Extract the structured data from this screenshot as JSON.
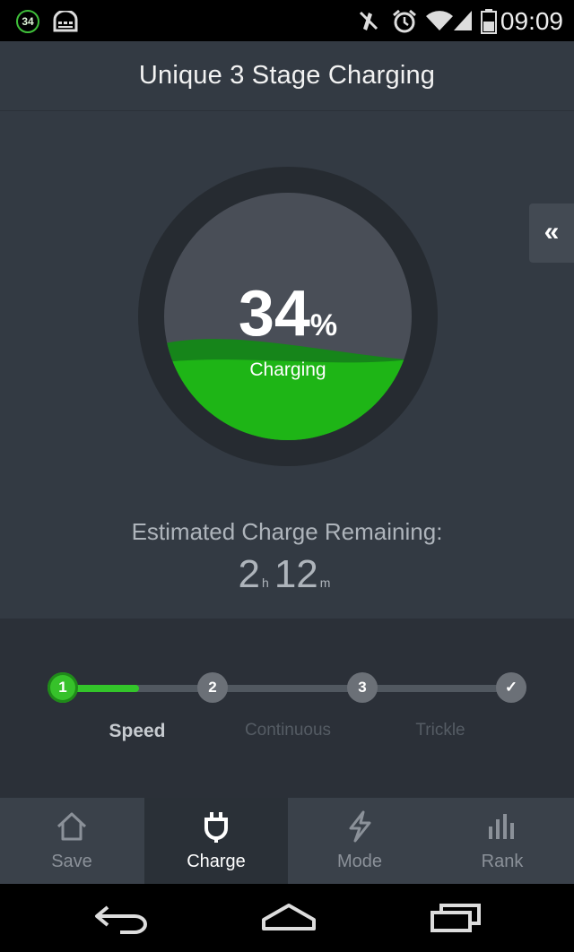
{
  "status_bar": {
    "badge": "34",
    "time": "09:09",
    "icons": [
      "battery-badge-icon",
      "keyboard-icon",
      "mute-icon",
      "alarm-icon",
      "wifi-icon",
      "signal-icon",
      "battery-icon"
    ]
  },
  "app": {
    "title": "Unique 3 Stage Charging",
    "side_tab_label": "«"
  },
  "gauge": {
    "percent": "34",
    "percent_unit": "%",
    "state": "Charging",
    "level": 0.34,
    "colors": {
      "fill": "#1eb516",
      "ring": "#262b31",
      "face": "#494e57"
    }
  },
  "estimate": {
    "label": "Estimated Charge Remaining:",
    "hours": "2",
    "hours_unit": "h",
    "minutes": "12",
    "minutes_unit": "m"
  },
  "stages": {
    "progress": 0.17,
    "nodes": [
      "1",
      "2",
      "3",
      "✓"
    ],
    "labels": [
      "Speed",
      "Continuous",
      "Trickle"
    ],
    "active_index": 0
  },
  "nav": {
    "items": [
      {
        "label": "Save",
        "icon": "house-icon"
      },
      {
        "label": "Charge",
        "icon": "plug-icon"
      },
      {
        "label": "Mode",
        "icon": "lightning-icon"
      },
      {
        "label": "Rank",
        "icon": "bar-chart-icon"
      }
    ],
    "selected": 1
  },
  "android_nav": {
    "icons": [
      "back-icon",
      "home-icon",
      "recents-icon"
    ]
  }
}
